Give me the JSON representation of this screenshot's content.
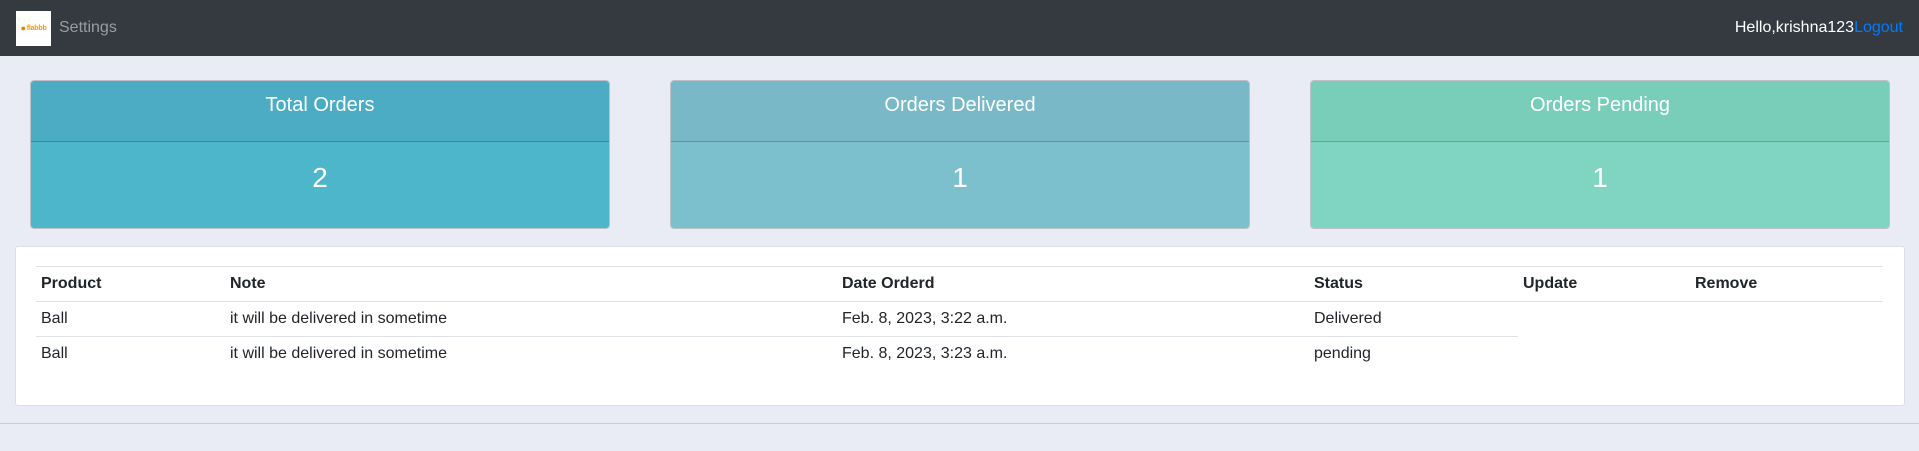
{
  "navbar": {
    "logo_text": "flabbb",
    "settings_label": "Settings",
    "greeting": "Hello,krishna123",
    "logout_label": "Logout"
  },
  "cards": {
    "total": {
      "title": "Total Orders",
      "value": "2"
    },
    "delivered": {
      "title": "Orders Delivered",
      "value": "1"
    },
    "pending": {
      "title": "Orders Pending",
      "value": "1"
    }
  },
  "orders_table": {
    "headers": [
      "Product",
      "Note",
      "Date Orderd",
      "Status",
      "Update",
      "Remove"
    ],
    "rows": [
      {
        "product": "Ball",
        "note": "it will be delivered in sometime",
        "date": "Feb. 8, 2023, 3:22 a.m.",
        "status": "Delivered"
      },
      {
        "product": "Ball",
        "note": "it will be delivered in sometime",
        "date": "Feb. 8, 2023, 3:23 a.m.",
        "status": "pending"
      }
    ]
  },
  "colors": {
    "navbar_bg": "#343a40",
    "link": "#007bff",
    "total_card": "#4db6ca",
    "delivered_card": "#7cbfcd",
    "pending_card": "#80d4c2"
  }
}
